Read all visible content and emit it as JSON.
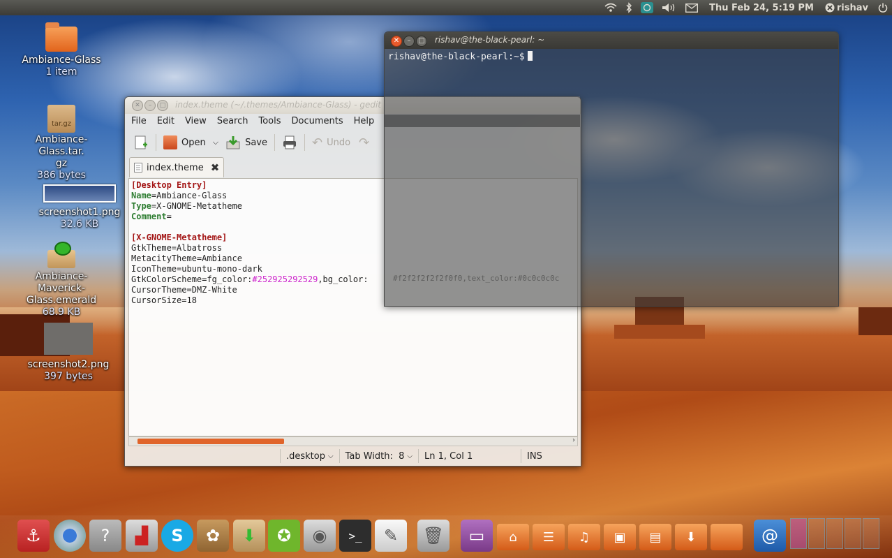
{
  "top_panel": {
    "clock": "Thu Feb 24,  5:19 PM",
    "user": "rishav",
    "icons": [
      "wifi-icon",
      "bluetooth-icon",
      "app-indicator-icon",
      "volume-icon",
      "mail-icon",
      "user-icon",
      "power-icon"
    ]
  },
  "desktop": {
    "items": [
      {
        "name": "Ambiance-Glass",
        "sub": "1 item",
        "icon": "folder-icon"
      },
      {
        "name": "Ambiance-Glass.tar.\ngz",
        "sub": "386 bytes",
        "icon": "archive-icon",
        "badge": "tar.gz"
      },
      {
        "name": "screenshot1.png",
        "sub": "32.6 KB",
        "icon": "image-icon"
      },
      {
        "name": "Ambiance-Maverick-\nGlass.emerald",
        "sub": "68.9 KB",
        "icon": "emerald-package-icon"
      },
      {
        "name": "screenshot2.png",
        "sub": "397 bytes",
        "icon": "image-icon"
      }
    ]
  },
  "gedit": {
    "title": "index.theme (~/.themes/Ambiance-Glass) - gedit",
    "menu": [
      "File",
      "Edit",
      "View",
      "Search",
      "Tools",
      "Documents",
      "Help"
    ],
    "toolbar": {
      "open": "Open",
      "save": "Save",
      "undo": "Undo"
    },
    "tab_label": "index.theme",
    "lines": {
      "l1": "[Desktop Entry]",
      "l2k": "Name",
      "l2v": "=Ambiance-Glass",
      "l3k": "Type",
      "l3v": "=X-GNOME-Metatheme",
      "l4k": "Comment",
      "l4v": "=",
      "l6": "[X-GNOME-Metatheme]",
      "l7": "GtkTheme=Albatross",
      "l8": "MetacityTheme=Ambiance",
      "l9": "IconTheme=ubuntu-mono-dark",
      "l10a": "GtkColorScheme=fg_color:",
      "l10b": "#252925292529",
      "l10c": ",bg_color:",
      "l11": "CursorTheme=DMZ-White",
      "l12": "CursorSize=18"
    },
    "status": {
      "lang": ".desktop",
      "tab_width": "Tab Width:  8",
      "position": "Ln 1, Col 1",
      "mode": "INS"
    }
  },
  "terminal": {
    "title": "rishav@the-black-pearl: ~",
    "prompt": "rishav@the-black-pearl:~$",
    "ghost_text": "#f2f2f2f2f2f0f0,text_color:#0c0c0c0c"
  },
  "dock": {
    "items": [
      "anchor-icon",
      "chromium-icon",
      "help-icon",
      "joystick-icon",
      "skype-icon",
      "ubuntu-software-icon",
      "downloads-folder-icon",
      "ubuntu-one-icon",
      "disk-icon",
      "terminal-icon",
      "text-editor-icon",
      "trash-icon",
      "computer-icon",
      "home-folder-icon",
      "documents-folder-icon",
      "music-folder-icon",
      "pictures-folder-icon",
      "videos-folder-icon",
      "download-folder-icon",
      "folder-icon",
      "mail-icon",
      "workspaces-icon"
    ]
  }
}
